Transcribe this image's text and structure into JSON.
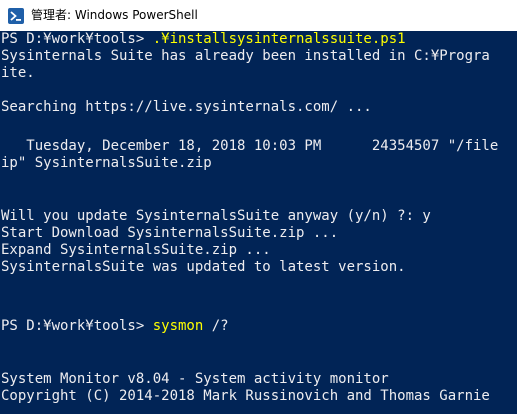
{
  "window": {
    "title": "管理者: Windows PowerShell",
    "icon": "powershell-icon",
    "colors": {
      "background": "#012456",
      "text": "#eeedf0",
      "command": "#ffff00"
    }
  },
  "console": {
    "line1": {
      "prompt": "PS D:¥work¥tools> ",
      "command": ".¥installsysinternalssuite.ps1"
    },
    "line2": "Sysinternals Suite has already been installed in C:¥Progra",
    "line3": "ite.",
    "line4": "",
    "line5": "Searching https://live.sysinternals.com/ ...",
    "line6": "",
    "line7": "",
    "line8": "   Tuesday, December 18, 2018 10:03 PM      24354507 \"/file",
    "line9": "ip\" SysinternalsSuite.zip",
    "line10": "",
    "line11": "",
    "line12": "Will you update SysinternalsSuite anyway (y/n) ?: y",
    "line13": "Start Download SysinternalsSuite.zip ...",
    "line14": "Expand SysinternalsSuite.zip ...",
    "line15": "SysinternalsSuite was updated to latest version.",
    "line16": "",
    "line17": "",
    "line18": {
      "prompt": "PS D:¥work¥tools> ",
      "command": "sysmon",
      "args": " /?"
    },
    "line19": "",
    "line20": "",
    "line21": "System Monitor v8.04 - System activity monitor",
    "line22": "Copyright (C) 2014-2018 Mark Russinovich and Thomas Garnie"
  }
}
